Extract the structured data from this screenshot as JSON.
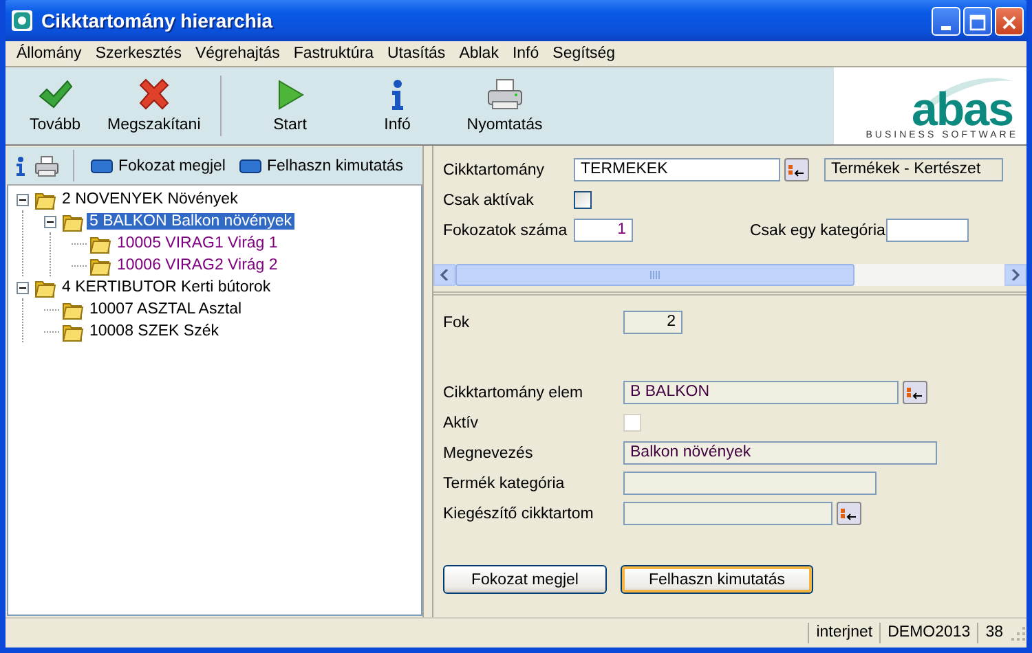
{
  "window": {
    "title": "Cikktartomány hierarchia"
  },
  "menu": [
    "Állomány",
    "Szerkesztés",
    "Végrehajtás",
    "Fastruktúra",
    "Utasítás",
    "Ablak",
    "Infó",
    "Segítség"
  ],
  "toolbar": [
    {
      "kind": "check",
      "label": "Tovább"
    },
    {
      "kind": "cancel",
      "label": "Megszakítani"
    },
    {
      "kind": "start",
      "label": "Start"
    },
    {
      "kind": "info",
      "label": "Infó"
    },
    {
      "kind": "print",
      "label": "Nyomtatás"
    }
  ],
  "logo": {
    "name": "abas",
    "tagline": "BUSINESS SOFTWARE"
  },
  "tree_toolbar": {
    "buttons": [
      "Fokozat megjel",
      "Felhaszn kimutatás"
    ]
  },
  "tree": {
    "items": [
      {
        "label": "2 NOVENYEK Növények",
        "expanded": true,
        "selected": false,
        "children": [
          {
            "label": "5 BALKON Balkon növények",
            "expanded": true,
            "selected": true,
            "children": [
              {
                "label": "10005 VIRAG1 Virág 1",
                "selected": false,
                "color": "#800080"
              },
              {
                "label": "10006 VIRAG2 Virág 2",
                "selected": false,
                "color": "#800080"
              }
            ]
          }
        ]
      },
      {
        "label": "4 KERTIBUTOR Kerti bútorok",
        "expanded": true,
        "selected": false,
        "children": [
          {
            "label": "10007 ASZTAL Asztal",
            "selected": false,
            "color": "#000000"
          },
          {
            "label": "10008 SZEK Szék",
            "selected": false,
            "color": "#000000"
          }
        ]
      }
    ]
  },
  "header_form": {
    "cikktartomany": {
      "label": "Cikktartomány",
      "value": "TERMEKEK",
      "description": "Termékek - Kertészet"
    },
    "csak_aktivak": {
      "label": "Csak aktívak",
      "checked": false
    },
    "fokozatok_szama": {
      "label": "Fokozatok száma",
      "value": "1"
    },
    "csak_egy_kategoria": {
      "label": "Csak egy kategória"
    }
  },
  "detail_form": {
    "fok": {
      "label": "Fok",
      "value": "2"
    },
    "cikktartomany_elem": {
      "label": "Cikktartomány elem",
      "value": "B BALKON"
    },
    "aktiv": {
      "label": "Aktív",
      "checked": false
    },
    "megnevezes": {
      "label": "Megnevezés",
      "value": "Balkon növények"
    },
    "termek_kategoria": {
      "label": "Termék kategória"
    },
    "kiegeszito": {
      "label": "Kiegészítő cikktartom"
    }
  },
  "buttons": [
    {
      "label": "Fokozat megjel",
      "focused": false
    },
    {
      "label": "Felhaszn kimutatás",
      "focused": true
    }
  ],
  "status_bar": [
    "interjnet",
    "DEMO2013",
    "38"
  ]
}
